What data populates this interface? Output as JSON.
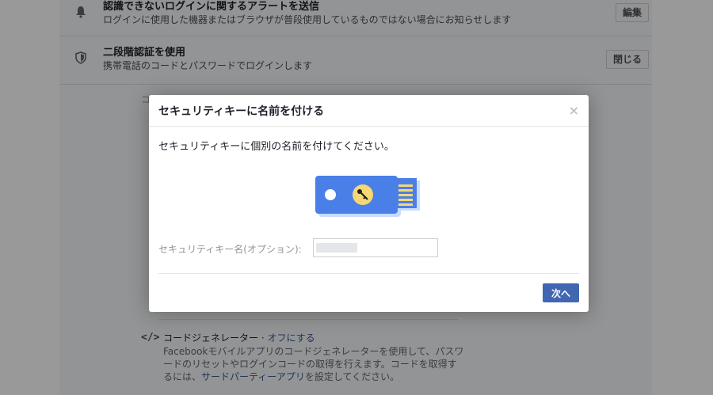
{
  "settings": {
    "login_alerts": {
      "title": "認識できないログインに関するアラートを送信",
      "description": "ログインに使用した機器またはブラウザが普段使用しているものではない場合にお知らせします",
      "button": "編集"
    },
    "two_factor": {
      "title": "二段階認証を使用",
      "description": "携帯電話のコードとパスワードでログインします",
      "button": "閉じる"
    }
  },
  "code_generator": {
    "icon": "</>",
    "title": "コードジェネレーター · ",
    "turn_off_link": "オフにする",
    "description_before": "Facebookモバイルアプリのコードジェネレーターを使用して、パスワードのリセットやログインコードの取得を行えます。コードを取得するには、",
    "third_party_link": "サードパーティーアプリ",
    "description_after": "を設定してください。"
  },
  "dialog": {
    "title": "セキュリティキーに名前を付ける",
    "close": "×",
    "instruction": "セキュリティキーに個別の名前を付けてください。",
    "field_label": "セキュリティキー名(オプション):",
    "field_value": "",
    "next_button": "次へ"
  },
  "colors": {
    "key_body": "#4a7fe8",
    "key_ring": "#f7d774",
    "key_contacts": "#f7d774",
    "primary_button": "#4267b2",
    "overlay": "rgba(0,0,0,0.40)"
  }
}
